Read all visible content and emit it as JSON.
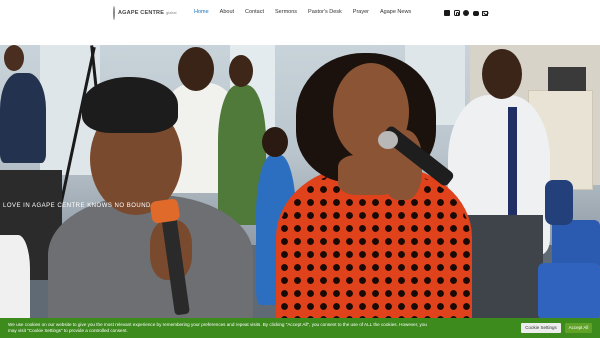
{
  "brand": {
    "name": "AGAPE CENTRE",
    "subtitle": "global"
  },
  "nav": {
    "items": [
      "Home",
      "About",
      "Contact",
      "Sermons",
      "Pastor's Desk",
      "Prayer",
      "Agape News"
    ],
    "active": "Home"
  },
  "social": [
    "facebook-icon",
    "instagram-icon",
    "whatsapp-icon",
    "youtube-icon",
    "email-icon"
  ],
  "hero": {
    "caption": "LOVE IN AGAPE CENTRE KNOWS NO BOUND"
  },
  "cookie_banner": {
    "text": "We use cookies on our website to give you the most relevant experience by remembering your preferences and repeat visits. By clicking \"Accept All\", you consent to the use of ALL the cookies. However, you may visit \"Cookie Settings\" to provide a controlled consent.",
    "settings_label": "Cookie Settings",
    "accept_label": "Accept All"
  },
  "colors": {
    "accent": "#1e73be",
    "cookie_bg": "#3d8a1d",
    "accept_bg": "#61a229",
    "dress": "#e0421b"
  }
}
